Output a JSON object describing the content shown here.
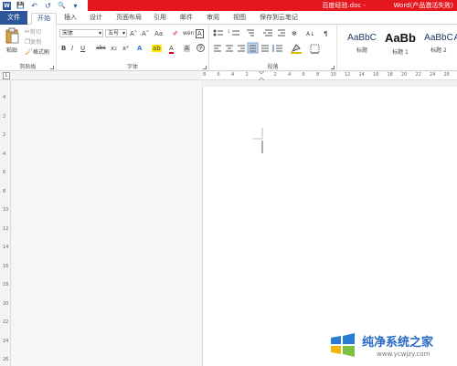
{
  "titlebar": {
    "doc_name": "百度经验.doc - ",
    "app_name": "Word(产品激活失败)"
  },
  "quick_access": {
    "save": "💾",
    "undo": "↶",
    "redo": "↺",
    "preview": "🔍",
    "more": "▾"
  },
  "tabs": [
    {
      "label": "文件"
    },
    {
      "label": "开始"
    },
    {
      "label": "插入"
    },
    {
      "label": "设计"
    },
    {
      "label": "页面布局"
    },
    {
      "label": "引用"
    },
    {
      "label": "邮件"
    },
    {
      "label": "审阅"
    },
    {
      "label": "视图"
    },
    {
      "label": "保存到云笔记"
    }
  ],
  "clipboard": {
    "paste": "粘贴",
    "cut": "剪切",
    "copy": "复制",
    "format_painter": "格式刷",
    "group_label": "剪贴板"
  },
  "font": {
    "name": "宋体",
    "size": "五号",
    "grow": "A˄",
    "shrink": "A˅",
    "case": "Aa",
    "clear": "✐",
    "phonetic": "wén",
    "border_char": "A",
    "bold": "B",
    "italic": "I",
    "underline": "U",
    "strike": "abc",
    "subscript": "x₂",
    "superscript": "x²",
    "effects": "A",
    "highlight": "ab",
    "color": "A",
    "shade": "A",
    "circle": "字",
    "group_label": "字体"
  },
  "paragraph": {
    "group_label": "段落"
  },
  "styles": [
    {
      "preview": "AaBbC",
      "name": "标题"
    },
    {
      "preview": "AaBb",
      "name": "标题 1"
    },
    {
      "preview": "AaBbC",
      "name": "标题 2"
    },
    {
      "preview": "A",
      "name": ""
    }
  ],
  "ruler": {
    "corner": "L",
    "h_numbers": [
      "8",
      "6",
      "4",
      "2",
      "",
      "2",
      "4",
      "6",
      "8",
      "10",
      "12",
      "14",
      "16",
      "18",
      "20",
      "22",
      "24",
      "26",
      "28"
    ],
    "v_numbers": [
      "4",
      "2",
      "2",
      "4",
      "6",
      "8",
      "10",
      "12",
      "14",
      "16",
      "18",
      "20",
      "22",
      "24",
      "26"
    ]
  },
  "watermark": {
    "title": "纯净系统之家",
    "url": "www.ycwjzy.com"
  },
  "colors": {
    "title_red": "#e5161c",
    "file_tab": "#2b579a",
    "highlight_yellow": "#ffe600",
    "font_red": "#e00000"
  }
}
